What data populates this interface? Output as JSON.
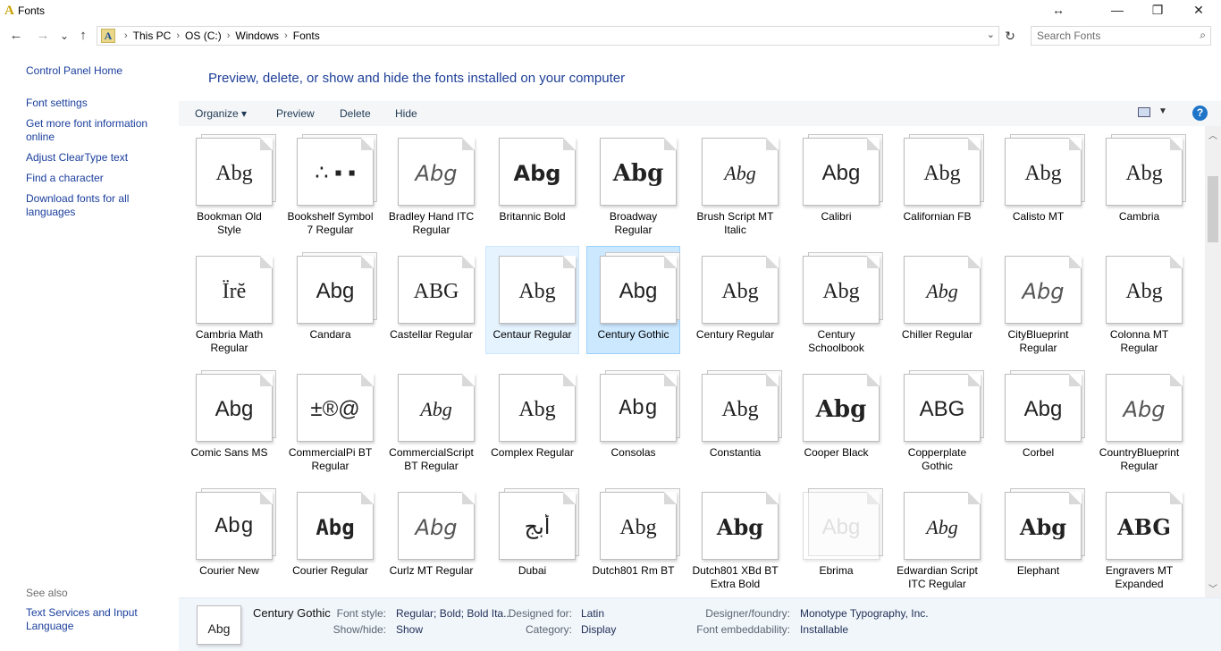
{
  "window": {
    "title": "Fonts",
    "resize_glyph": "↔",
    "minimize_glyph": "—",
    "maximize_glyph": "❐",
    "close_glyph": "✕"
  },
  "nav": {
    "back": "←",
    "forward": "→",
    "recent": "⌄",
    "up": "↑",
    "crumbs": [
      "This PC",
      "OS (C:)",
      "Windows",
      "Fonts"
    ],
    "separator": "›",
    "refresh": "↻",
    "search_placeholder": "Search Fonts"
  },
  "left_pane": {
    "links": [
      {
        "label": "Control Panel Home"
      },
      {
        "label": "Font settings"
      },
      {
        "label": "Get more font information online"
      },
      {
        "label": "Adjust ClearType text"
      },
      {
        "label": "Find a character"
      },
      {
        "label": "Download fonts for all languages"
      }
    ],
    "see_also_label": "See also",
    "see_also_links": [
      {
        "label": "Text Services and Input Language"
      }
    ]
  },
  "main": {
    "heading": "Preview, delete, or show and hide the fonts installed on your computer",
    "toolbar": {
      "organize": "Organize ▾",
      "preview": "Preview",
      "delete": "Delete",
      "hide": "Hide",
      "help": "?"
    }
  },
  "fonts": [
    {
      "name": "Bookman Old Style",
      "sample": "Abg",
      "family": "serif",
      "stack": true
    },
    {
      "name": "Bookshelf Symbol 7 Regular",
      "sample": "∴ ▪ ▪",
      "family": "sans",
      "stack": true
    },
    {
      "name": "Bradley Hand ITC Regular",
      "sample": "Abg",
      "family": "hand",
      "stack": false
    },
    {
      "name": "Britannic Bold",
      "sample": "Abg",
      "family": "boldsans",
      "stack": false
    },
    {
      "name": "Broadway Regular",
      "sample": "Abg",
      "family": "heavy",
      "stack": false
    },
    {
      "name": "Brush Script MT Italic",
      "sample": "Abg",
      "family": "script",
      "stack": false
    },
    {
      "name": "Calibri",
      "sample": "Abg",
      "family": "sans",
      "stack": true
    },
    {
      "name": "Californian FB",
      "sample": "Abg",
      "family": "serif",
      "stack": true
    },
    {
      "name": "Calisto MT",
      "sample": "Abg",
      "family": "serif",
      "stack": true
    },
    {
      "name": "Cambria",
      "sample": "Abg",
      "family": "serif",
      "stack": true
    },
    {
      "name": "Cambria Math Regular",
      "sample": "Ïrĕ",
      "family": "serif",
      "stack": false
    },
    {
      "name": "Candara",
      "sample": "Abg",
      "family": "sans",
      "stack": true
    },
    {
      "name": "Castellar Regular",
      "sample": "ABG",
      "family": "serif",
      "stack": false
    },
    {
      "name": "Centaur Regular",
      "sample": "Abg",
      "family": "serif",
      "stack": false
    },
    {
      "name": "Century Gothic",
      "sample": "Abg",
      "family": "sans",
      "stack": true
    },
    {
      "name": "Century Regular",
      "sample": "Abg",
      "family": "serif",
      "stack": false
    },
    {
      "name": "Century Schoolbook",
      "sample": "Abg",
      "family": "serif",
      "stack": true
    },
    {
      "name": "Chiller Regular",
      "sample": "Abg",
      "family": "script",
      "stack": false
    },
    {
      "name": "CityBlueprint Regular",
      "sample": "Abg",
      "family": "hand",
      "stack": false
    },
    {
      "name": "Colonna MT Regular",
      "sample": "Abg",
      "family": "serif",
      "stack": false
    },
    {
      "name": "Comic Sans MS",
      "sample": "Abg",
      "family": "sans",
      "stack": true
    },
    {
      "name": "CommercialPi BT Regular",
      "sample": "±®@",
      "family": "sans",
      "stack": false
    },
    {
      "name": "CommercialScript BT Regular",
      "sample": "Abg",
      "family": "script",
      "stack": false
    },
    {
      "name": "Complex Regular",
      "sample": "Abg",
      "family": "serif",
      "stack": false
    },
    {
      "name": "Consolas",
      "sample": "Abg",
      "family": "mono",
      "stack": true
    },
    {
      "name": "Constantia",
      "sample": "Abg",
      "family": "serif",
      "stack": true
    },
    {
      "name": "Cooper Black",
      "sample": "Abg",
      "family": "heavy",
      "stack": false
    },
    {
      "name": "Copperplate Gothic",
      "sample": "ABG",
      "family": "sans",
      "stack": true
    },
    {
      "name": "Corbel",
      "sample": "Abg",
      "family": "sans",
      "stack": true
    },
    {
      "name": "CountryBlueprint Regular",
      "sample": "Abg",
      "family": "hand",
      "stack": false
    },
    {
      "name": "Courier New",
      "sample": "Abg",
      "family": "mono",
      "stack": true
    },
    {
      "name": "Courier Regular",
      "sample": "Abg",
      "family": "monobold",
      "stack": false
    },
    {
      "name": "Curlz MT Regular",
      "sample": "Abg",
      "family": "hand",
      "stack": false
    },
    {
      "name": "Dubai",
      "sample": "أبج",
      "family": "sans",
      "stack": true
    },
    {
      "name": "Dutch801 Rm BT",
      "sample": "Abg",
      "family": "serif",
      "stack": true
    },
    {
      "name": "Dutch801 XBd BT Extra Bold",
      "sample": "Abg",
      "family": "heavyserif",
      "stack": false
    },
    {
      "name": "Ebrima",
      "sample": "Abg",
      "family": "faded",
      "stack": true
    },
    {
      "name": "Edwardian Script ITC Regular",
      "sample": "Abg",
      "family": "script",
      "stack": false
    },
    {
      "name": "Elephant",
      "sample": "Abg",
      "family": "heavyserif",
      "stack": true
    },
    {
      "name": "Engravers MT Expanded",
      "sample": "ABG",
      "family": "heavyserif",
      "stack": false
    }
  ],
  "selection": {
    "selected_index": 14,
    "hover_index": 13
  },
  "details": {
    "thumb_sample": "Abg",
    "name": "Century Gothic",
    "font_style_label": "Font style:",
    "font_style_value": "Regular; Bold; Bold Ita...",
    "show_hide_label": "Show/hide:",
    "show_hide_value": "Show",
    "designed_for_label": "Designed for:",
    "designed_for_value": "Latin",
    "category_label": "Category:",
    "category_value": "Display",
    "designer_label": "Designer/foundry:",
    "designer_value": "Monotype Typography, Inc.",
    "embeddability_label": "Font embeddability:",
    "embeddability_value": "Installable"
  },
  "colors": {
    "link": "#1a3e9c",
    "heading": "#1e3f98",
    "selection_bg": "#cce8ff",
    "help_blue": "#1e74c9"
  }
}
